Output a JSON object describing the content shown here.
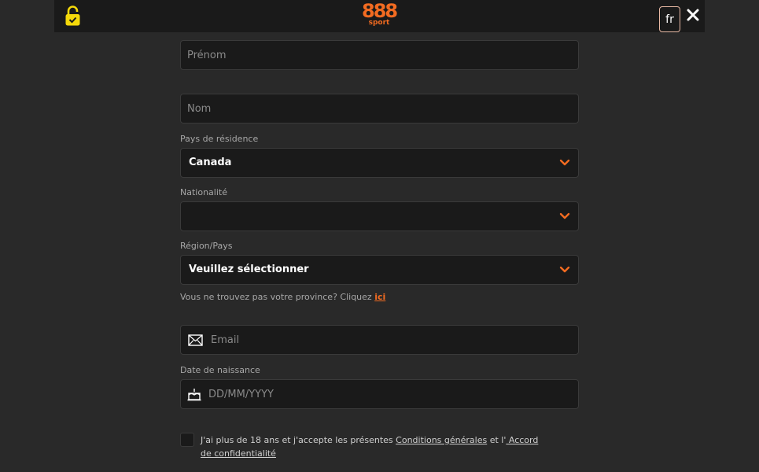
{
  "header": {
    "logo_number": "888",
    "logo_subtitle": "sport",
    "language": "fr"
  },
  "form": {
    "first_name": {
      "placeholder": "Prénom",
      "value": ""
    },
    "last_name": {
      "placeholder": "Nom",
      "value": ""
    },
    "country": {
      "label": "Pays de résidence",
      "value": "Canada"
    },
    "nationality": {
      "label": "Nationalité",
      "value": ""
    },
    "region": {
      "label": "Région/Pays",
      "value": "Veuillez sélectionner"
    },
    "province_help": {
      "text": "Vous ne trouvez pas votre province? Cliquez ",
      "link": "ici"
    },
    "email": {
      "placeholder": "Email",
      "value": ""
    },
    "birthdate": {
      "label": "Date de naissance",
      "placeholder": "DD/MM/YYYY",
      "value": ""
    },
    "terms": {
      "prefix": "J'ai plus de 18 ans et j'accepte les présentes ",
      "conditions_link": "Conditions générales",
      "middle": " et l'",
      "privacy_link": " Accord de confidentialité"
    }
  },
  "colors": {
    "accent": "#f26b21",
    "background": "#292929",
    "field_background": "#1a1a1a",
    "lock_icon": "#f5d90a"
  }
}
